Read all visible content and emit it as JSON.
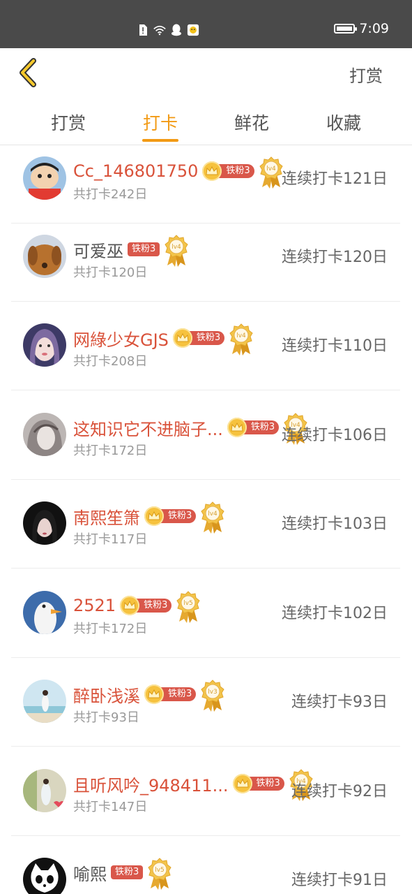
{
  "status": {
    "time": "7:09"
  },
  "header": {
    "action_label": "打赏"
  },
  "tabs": [
    {
      "label": "打赏",
      "active": false
    },
    {
      "label": "打卡",
      "active": true
    },
    {
      "label": "鲜花",
      "active": false
    },
    {
      "label": "收藏",
      "active": false
    }
  ],
  "colors": {
    "accent": "#f29a14",
    "name_highlight": "#d9523a",
    "fan_badge": "#d9574a"
  },
  "list": [
    {
      "name": "Cc_146801750",
      "highlight": true,
      "crown": true,
      "fan": "铁粉3",
      "level": "lv4",
      "total": "共打卡242日",
      "streak": "连续打卡121日",
      "avatar": "cartoon"
    },
    {
      "name": "可爱巫",
      "highlight": false,
      "crown": false,
      "fan": "铁粉3",
      "level": "lv4",
      "total": "共打卡120日",
      "streak": "连续打卡120日",
      "avatar": "dog"
    },
    {
      "name": "网綠少女GJS",
      "highlight": true,
      "crown": true,
      "fan": "铁粉3",
      "level": "lv4",
      "total": "共打卡208日",
      "streak": "连续打卡110日",
      "avatar": "girl"
    },
    {
      "name": "这知识它不进脑子...",
      "highlight": true,
      "crown": true,
      "fan": "铁粉3",
      "level": "lv4",
      "total": "共打卡172日",
      "streak": "连续打卡106日",
      "avatar": "sketch"
    },
    {
      "name": "南熙笙箫",
      "highlight": true,
      "crown": true,
      "fan": "铁粉3",
      "level": "lv4",
      "total": "共打卡117日",
      "streak": "连续打卡103日",
      "avatar": "dark"
    },
    {
      "name": "2521",
      "highlight": true,
      "crown": true,
      "fan": "铁粉3",
      "level": "lv5",
      "total": "共打卡172日",
      "streak": "连续打卡102日",
      "avatar": "goose"
    },
    {
      "name": "醉卧浅溪",
      "highlight": true,
      "crown": true,
      "fan": "铁粉3",
      "level": "lv3",
      "total": "共打卡93日",
      "streak": "连续打卡93日",
      "avatar": "beach"
    },
    {
      "name": "且听风吟_948411...",
      "highlight": true,
      "crown": true,
      "fan": "铁粉3",
      "level": "lv4",
      "total": "共打卡147日",
      "streak": "连续打卡92日",
      "avatar": "street"
    },
    {
      "name": "喻熙",
      "highlight": false,
      "crown": false,
      "fan": "铁粉3",
      "level": "lv5",
      "total": "",
      "streak": "连续打卡91日",
      "avatar": "cat"
    }
  ]
}
